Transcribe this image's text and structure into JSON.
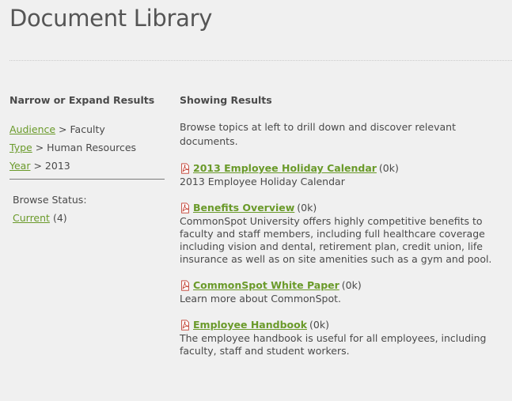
{
  "page": {
    "title": "Document Library"
  },
  "sidebar": {
    "heading": "Narrow or Expand Results",
    "filters": [
      {
        "label": "Audience",
        "separator": ">",
        "value": "Faculty"
      },
      {
        "label": "Type",
        "separator": ">",
        "value": "Human Resources"
      },
      {
        "label": "Year",
        "separator": ">",
        "value": "2013"
      }
    ],
    "browse_status": {
      "label": "Browse Status:",
      "current_label": "Current",
      "current_count": "(4)"
    }
  },
  "main": {
    "heading": "Showing Results",
    "intro": "Browse topics at left to drill down and discover relevant documents.",
    "documents": [
      {
        "title": "2013 Employee Holiday Calendar",
        "size": "(0k)",
        "description": "2013 Employee Holiday Calendar"
      },
      {
        "title": "Benefits Overview",
        "size": "(0k)",
        "description": "CommonSpot University offers highly competitive benefits to faculty and staff members, including full healthcare coverage including vision and dental, retirement plan, credit union, life insurance as well as on site amenities such as a gym and pool."
      },
      {
        "title": "CommonSpot White Paper",
        "size": "(0k)",
        "description": "Learn more about CommonSpot."
      },
      {
        "title": "Employee Handbook",
        "size": "(0k)",
        "description": "The employee handbook is useful for all employees, including faculty, staff and student workers."
      }
    ]
  },
  "icons": {
    "document": "pdf-icon"
  },
  "colors": {
    "background": "#f0f0f0",
    "link": "#6a9a2a",
    "text": "#4a4a4a",
    "pdf_icon": "#c0392b"
  }
}
